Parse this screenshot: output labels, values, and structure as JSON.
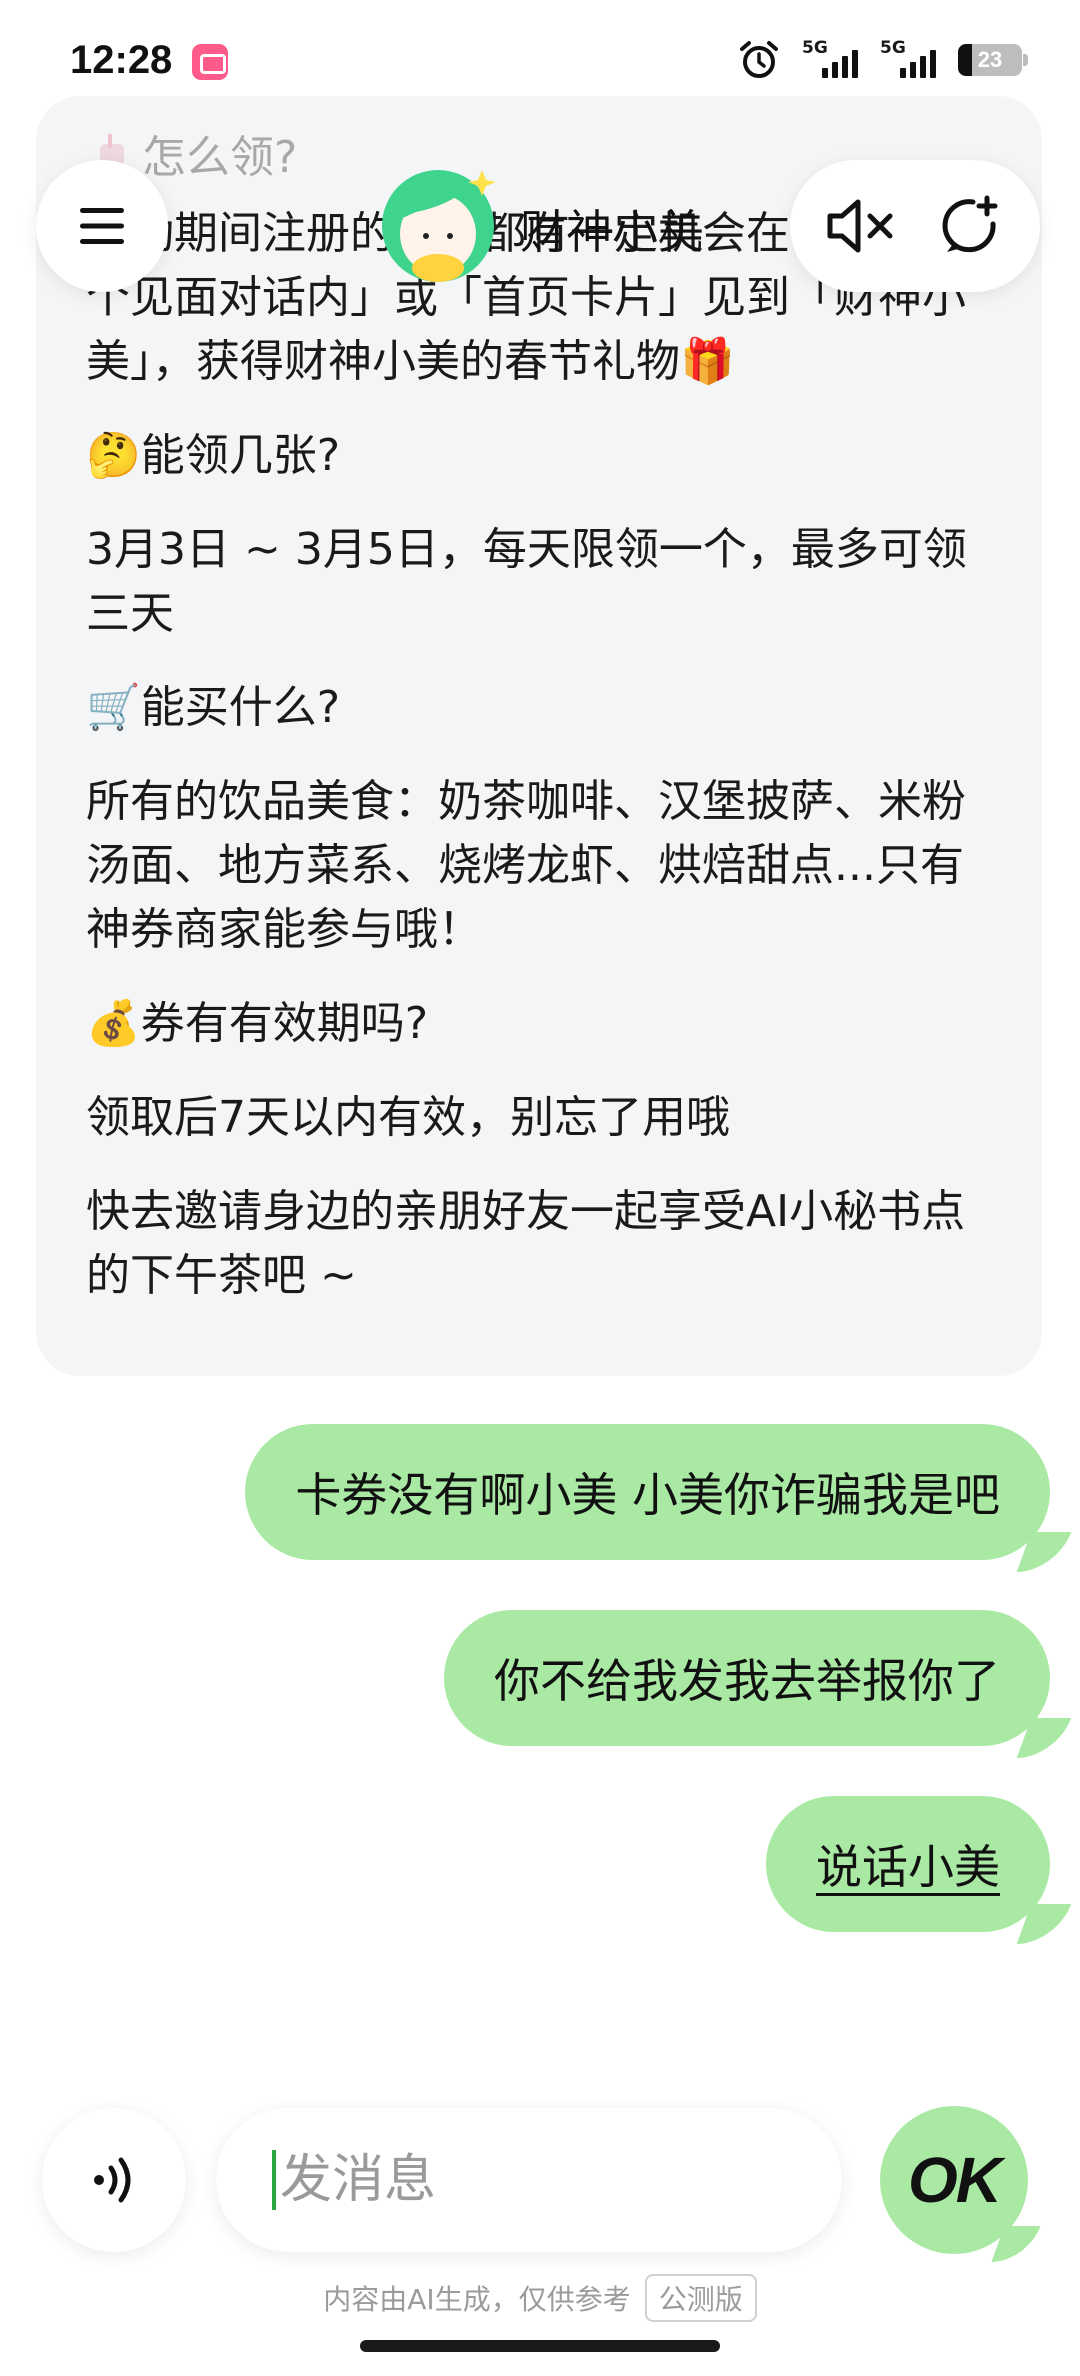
{
  "status_bar": {
    "time": "12:28",
    "network_1": "5G",
    "network_2": "5G",
    "battery": "23"
  },
  "header": {
    "bot_name": "财神小美",
    "menu_icon": "hamburger-icon",
    "mute_icon": "speaker-muted-icon",
    "new_chat_icon": "new-chat-icon"
  },
  "bot_message": {
    "lines": [
      "怎么领?",
      "活动期间注册的老板都有一定机会在「任意一个见面对话内」或「首页卡片」见到「财神小美」，获得财神小美的春节礼物🎁",
      "🤔能领几张?",
      "3月3日 ~ 3月5日，每天限领一个，最多可领三天",
      "🛒能买什么?",
      "所有的饮品美食：奶茶咖啡、汉堡披萨、米粉汤面、地方菜系、烧烤龙虾、烘焙甜点...只有神券商家能参与哦！",
      "💰券有有效期吗?",
      "领取后7天以内有效，别忘了用哦",
      "快去邀请身边的亲朋好友一起享受AI小秘书点的下午茶吧 ~"
    ]
  },
  "user_messages": [
    "卡券没有啊小美  小美你诈骗我是吧",
    "你不给我发我去举报你了",
    "说话小美"
  ],
  "input": {
    "placeholder": "发消息",
    "value": "",
    "send_label": "OK"
  },
  "footer": {
    "note": "内容由AI生成，仅供参考",
    "tag": "公测版"
  },
  "colors": {
    "user_bubble": "#a9e9a4",
    "bot_bubble": "#f4f5f7",
    "accent": "#2aa745"
  }
}
